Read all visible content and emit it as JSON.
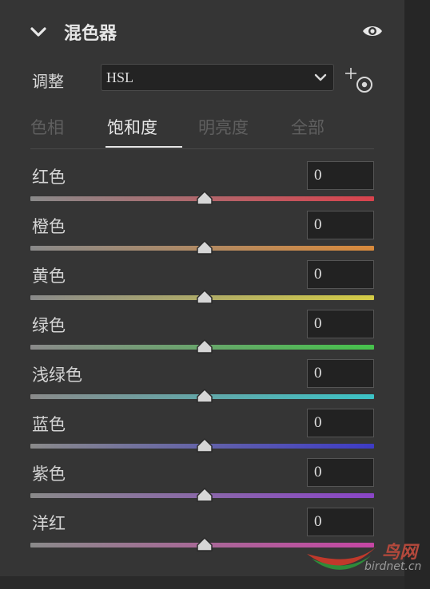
{
  "panel": {
    "title": "混色器"
  },
  "adjust": {
    "label": "调整",
    "selected": "HSL"
  },
  "tabs": [
    {
      "label": "色相",
      "active": false
    },
    {
      "label": "饱和度",
      "active": true
    },
    {
      "label": "明亮度",
      "active": false
    },
    {
      "label": "全部",
      "active": false
    }
  ],
  "colors": [
    {
      "label": "红色",
      "value": "0",
      "track_color": "#d9434d"
    },
    {
      "label": "橙色",
      "value": "0",
      "track_color": "#d98a3c"
    },
    {
      "label": "黄色",
      "value": "0",
      "track_color": "#d4cc46"
    },
    {
      "label": "绿色",
      "value": "0",
      "track_color": "#46c24c"
    },
    {
      "label": "浅绿色",
      "value": "0",
      "track_color": "#3cc3c6"
    },
    {
      "label": "蓝色",
      "value": "0",
      "track_color": "#3d3bc6"
    },
    {
      "label": "紫色",
      "value": "0",
      "track_color": "#8a45c7"
    },
    {
      "label": "洋红",
      "value": "0",
      "track_color": "#c646a4"
    }
  ],
  "slider_level_fraction": 0.5,
  "watermark": {
    "brand": "鸟网",
    "domain": "birdnet.cn"
  },
  "icons": {
    "collapse": "chevron-down-icon",
    "visibility": "eye-icon",
    "target_adjust": "target-adjustment-icon"
  }
}
